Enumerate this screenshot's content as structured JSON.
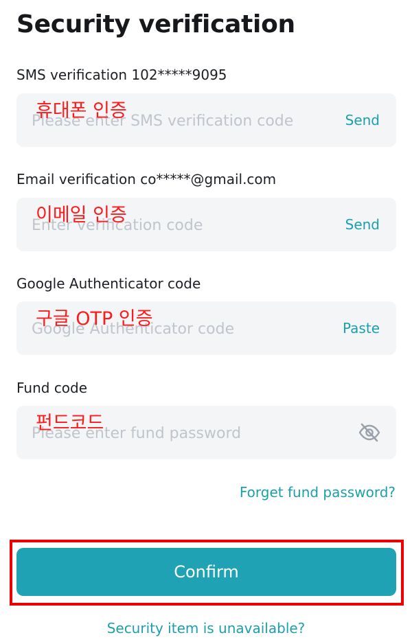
{
  "page": {
    "title": "Security verification"
  },
  "sms": {
    "label": "SMS verification 102*****9095",
    "placeholder": "Please enter SMS verification code",
    "action": "Send",
    "note": "휴대폰 인증"
  },
  "email": {
    "label": "Email verification co*****@gmail.com",
    "placeholder": "Enter verification code",
    "action": "Send",
    "note": "이메일 인증"
  },
  "google": {
    "label": "Google Authenticator code",
    "placeholder": "Google Authenticator code",
    "action": "Paste",
    "note": "구글 OTP 인증"
  },
  "fund": {
    "label": "Fund code",
    "placeholder": "Please enter fund password",
    "toggle_icon": "eye-off-icon",
    "note": "펀드코드"
  },
  "links": {
    "forget": "Forget fund password?",
    "unavailable": "Security item is unavailable?"
  },
  "buttons": {
    "confirm": "Confirm"
  },
  "colors": {
    "accent": "#1fa2b3",
    "link": "#1b9fad",
    "annotation": "#ee0000"
  }
}
